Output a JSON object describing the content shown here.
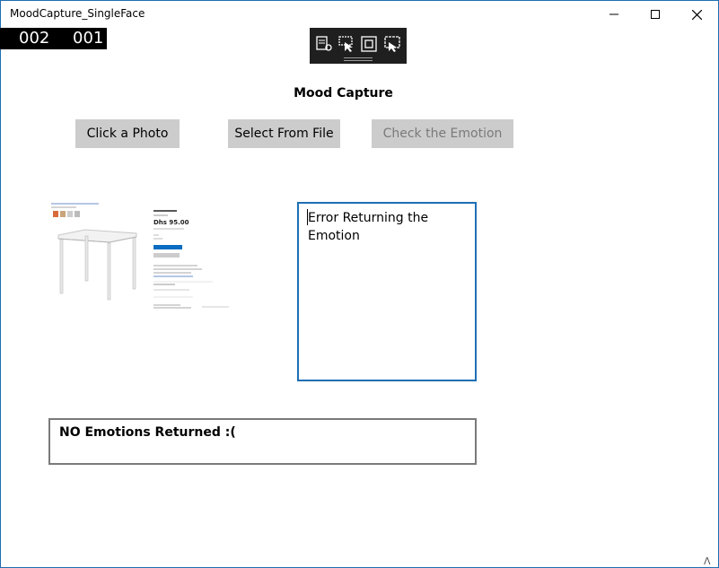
{
  "window": {
    "title": "MoodCapture_SingleFace",
    "minimize_icon": "minimize-icon",
    "maximize_icon": "maximize-icon",
    "close_icon": "close-icon"
  },
  "frame_counter": {
    "left": "002",
    "right": "001"
  },
  "debug_toolbar": {
    "icons": [
      "live-visual-tree-icon",
      "select-element-icon",
      "display-layout-adorners-icon",
      "track-focused-element-icon"
    ]
  },
  "app": {
    "heading": "Mood Capture",
    "buttons": {
      "click_photo": "Click a Photo",
      "select_file": "Select From File",
      "check_emotion": "Check the Emotion"
    },
    "photo": {
      "price": "Dhs 95.00"
    },
    "result_text": "Error Returning the Emotion",
    "emotions_status": "NO Emotions Returned :(",
    "corner_glyph": "Λ"
  },
  "colors": {
    "accent": "#1e6fb5",
    "button_bg": "#cccccc",
    "disabled_text": "#7a7a7a",
    "debugbar_bg": "#1f1f1f"
  }
}
